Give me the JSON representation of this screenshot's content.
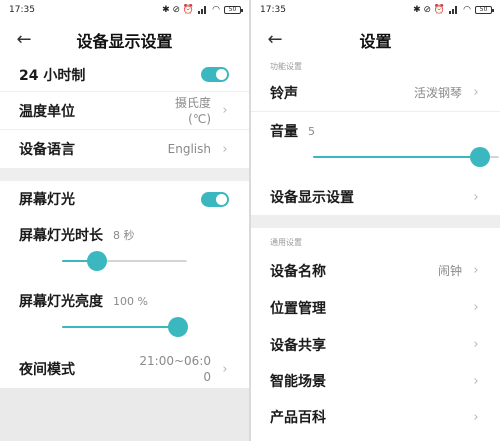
{
  "left": {
    "status": {
      "time": "17:35",
      "icons": "✱ ⊘ ⏰",
      "battery": "50"
    },
    "title": "设备显示设置",
    "rows": {
      "clock": {
        "label": "24 小时制"
      },
      "temp": {
        "label": "温度单位",
        "value_line1": "摄氏度",
        "value_line2": "(℃)"
      },
      "language": {
        "label": "设备语言",
        "value": "English"
      },
      "backlight": {
        "label": "屏幕灯光"
      },
      "duration": {
        "label": "屏幕灯光时长",
        "value": "8 秒",
        "slider_fraction": 0.28
      },
      "brightness": {
        "label": "屏幕灯光亮度",
        "value": "100 %",
        "slider_fraction": 1.0
      },
      "night": {
        "label": "夜间模式",
        "value_line1": "21:00~06:0",
        "value_line2": "0"
      }
    }
  },
  "right": {
    "status": {
      "time": "17:35",
      "icons": "✱ ⊘ ⏰",
      "battery": "50"
    },
    "title": "设置",
    "section_function": "功能设置",
    "rows": {
      "ringtone": {
        "label": "铃声",
        "value": "活泼钢琴"
      },
      "volume": {
        "label": "音量",
        "value": "5",
        "slider_fraction": 0.9
      },
      "display": {
        "label": "设备显示设置"
      },
      "name": {
        "label": "设备名称",
        "value": "闹钟"
      },
      "location": {
        "label": "位置管理"
      },
      "share": {
        "label": "设备共享"
      },
      "scene": {
        "label": "智能场景"
      },
      "encyclopedia": {
        "label": "产品百科"
      }
    },
    "section_general": "通用设置"
  },
  "colors": {
    "accent": "#3bb8bf",
    "divider": "#eeeeee",
    "gray_text": "#8a8a8a"
  },
  "icons": {
    "back": "back-arrow-icon",
    "chevron": "chevron-right-icon"
  }
}
